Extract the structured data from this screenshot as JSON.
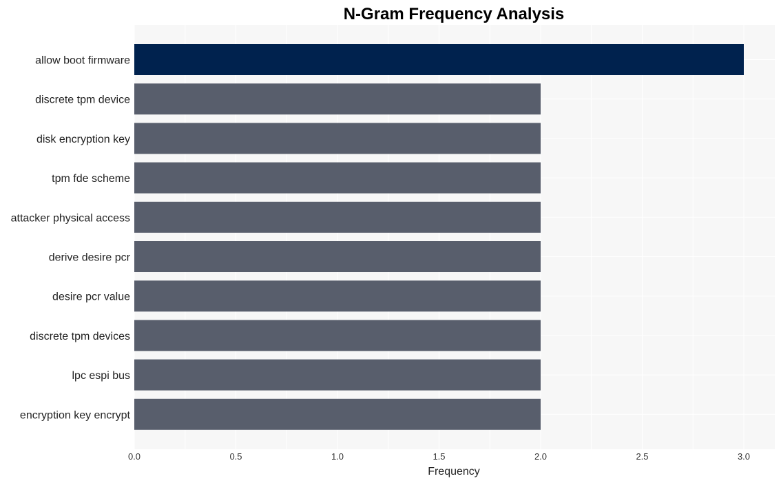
{
  "chart_data": {
    "type": "bar",
    "orientation": "horizontal",
    "title": "N-Gram Frequency Analysis",
    "xlabel": "Frequency",
    "ylabel": "",
    "xlim": [
      0,
      3.15
    ],
    "xticks": [
      0.0,
      0.5,
      1.0,
      1.5,
      2.0,
      2.5,
      3.0
    ],
    "xtick_labels": [
      "0.0",
      "0.5",
      "1.0",
      "1.5",
      "2.0",
      "2.5",
      "3.0"
    ],
    "grid": true,
    "categories": [
      "allow boot firmware",
      "discrete tpm device",
      "disk encryption key",
      "tpm fde scheme",
      "attacker physical access",
      "derive desire pcr",
      "desire pcr value",
      "discrete tpm devices",
      "lpc espi bus",
      "encryption key encrypt"
    ],
    "values": [
      3,
      2,
      2,
      2,
      2,
      2,
      2,
      2,
      2,
      2
    ],
    "colors": {
      "highlight": "#00224e",
      "default": "#585e6c",
      "plot_background": "#f7f7f7",
      "grid": "#ffffff"
    }
  }
}
